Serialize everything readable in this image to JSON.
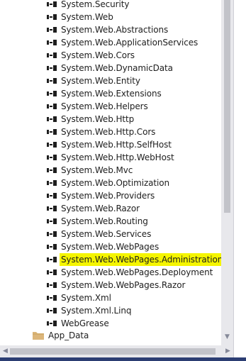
{
  "references": [
    "System.Security",
    "System.Web",
    "System.Web.Abstractions",
    "System.Web.ApplicationServices",
    "System.Web.Cors",
    "System.Web.DynamicData",
    "System.Web.Entity",
    "System.Web.Extensions",
    "System.Web.Helpers",
    "System.Web.Http",
    "System.Web.Http.Cors",
    "System.Web.Http.SelfHost",
    "System.Web.Http.WebHost",
    "System.Web.Mvc",
    "System.Web.Optimization",
    "System.Web.Providers",
    "System.Web.Razor",
    "System.Web.Routing",
    "System.Web.Services",
    "System.Web.WebPages",
    "System.Web.WebPages.Administration",
    "System.Web.WebPages.Deployment",
    "System.Web.WebPages.Razor",
    "System.Xml",
    "System.Xml.Linq",
    "WebGrease"
  ],
  "highlighted": "System.Web.WebPages.Administration",
  "folder": {
    "label": "App_Data",
    "icon": "folder-icon"
  },
  "colors": {
    "highlight": "#f5f500",
    "folder": "#dcb67a",
    "scrollbar": "#e8e8ec",
    "thumb": "#c2c3c9"
  },
  "icons": {
    "reference": "reference-icon"
  }
}
